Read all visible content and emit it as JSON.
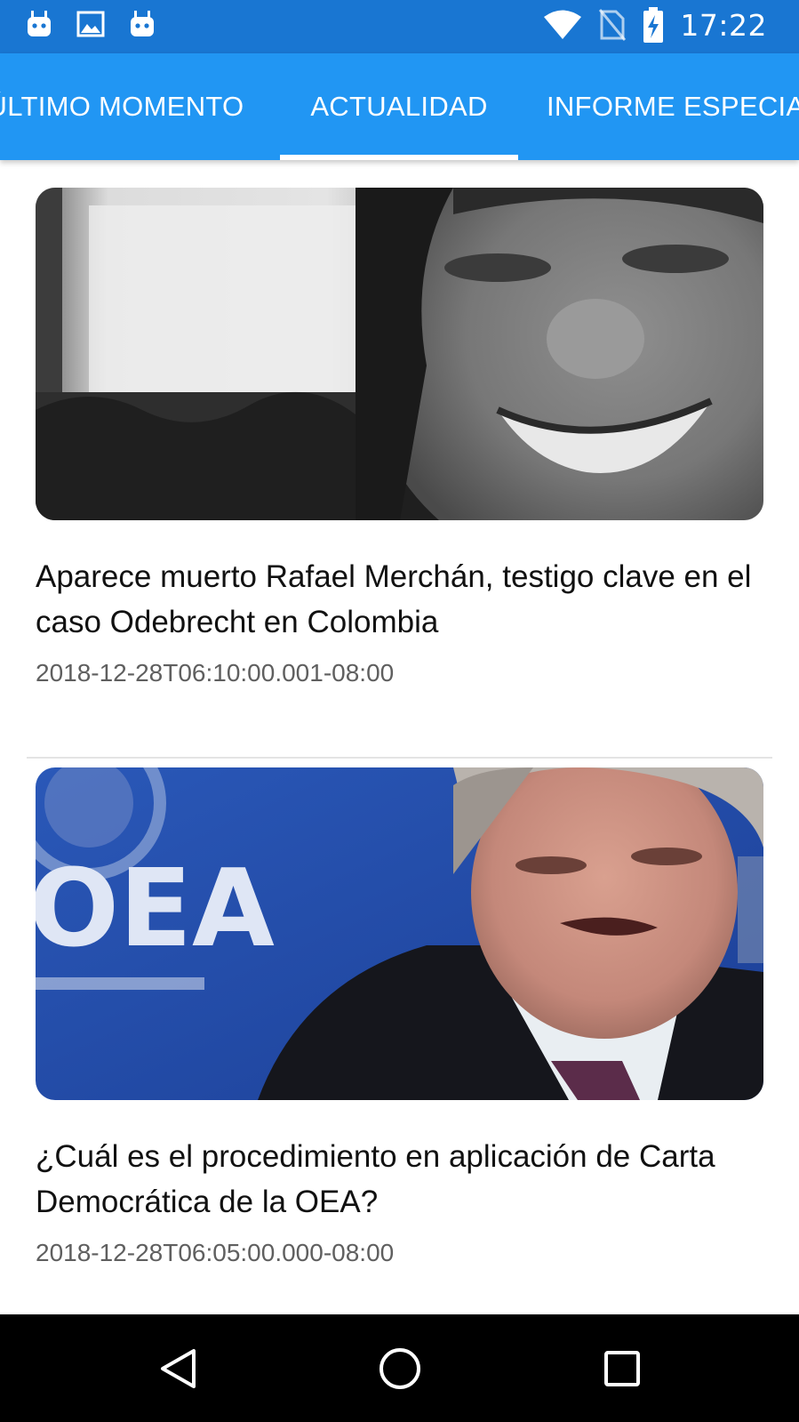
{
  "status_bar": {
    "time": "17:22",
    "left_icons": [
      "android-notification-icon",
      "image-notification-icon",
      "android-notification-icon"
    ],
    "right_icons": [
      "wifi-icon",
      "no-sim-icon",
      "battery-charging-icon"
    ],
    "background_color": "#1976D2"
  },
  "tabs": {
    "background_color": "#2196F3",
    "selected_index": 1,
    "items": [
      {
        "label": "ÚLTIMO MOMENTO"
      },
      {
        "label": "ACTUALIDAD"
      },
      {
        "label": "INFORME ESPECIAL"
      }
    ]
  },
  "articles": [
    {
      "title": "Aparece muerto Rafael Merchán, testigo clave en el caso Odebrecht en Colombia",
      "date": "2018-12-28T06:10:00.001-08:00"
    },
    {
      "title": "¿Cuál es el procedimiento en aplicación de Carta Democrática de la OEA?",
      "date": "2018-12-28T06:05:00.000-08:00",
      "image_text": "OEA"
    }
  ],
  "nav_bar": {
    "buttons": [
      "back-icon",
      "home-icon",
      "recents-icon"
    ]
  }
}
